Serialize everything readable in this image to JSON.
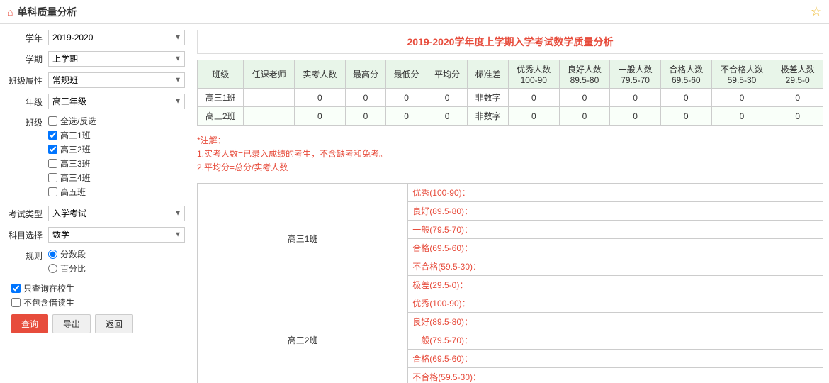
{
  "header": {
    "title": "单科质量分析",
    "star_icon": "☆"
  },
  "sidebar": {
    "fields": [
      {
        "label": "学年",
        "value": "2019-2020"
      },
      {
        "label": "学期",
        "value": "上学期"
      },
      {
        "label": "班级属性",
        "value": "常规班"
      },
      {
        "label": "年级",
        "value": "高三年级"
      }
    ],
    "class_label": "班级",
    "select_all_label": "全选/反选",
    "classes": [
      {
        "name": "高三1班",
        "checked": true
      },
      {
        "name": "高三2班",
        "checked": true
      },
      {
        "name": "高三3班",
        "checked": false
      },
      {
        "name": "高三4班",
        "checked": false
      },
      {
        "name": "高五班",
        "checked": false
      }
    ],
    "exam_type_label": "考试类型",
    "exam_type_value": "入学考试",
    "subject_label": "科目选择",
    "subject_value": "数学",
    "rules_label": "规则",
    "rules": [
      {
        "name": "分数段",
        "checked": true
      },
      {
        "name": "百分比",
        "checked": false
      }
    ],
    "extra_options": [
      {
        "label": "只查询在校生",
        "checked": true
      },
      {
        "label": "不包含借读生",
        "checked": false
      }
    ],
    "buttons": [
      {
        "label": "查询",
        "type": "primary"
      },
      {
        "label": "导出",
        "type": "default"
      },
      {
        "label": "返回",
        "type": "default"
      }
    ]
  },
  "content": {
    "report_title": "2019-2020学年度上学期入学考试数学质量分析",
    "table_headers": [
      "班级",
      "任课老师",
      "实考人数",
      "最高分",
      "最低分",
      "平均分",
      "标准差",
      "优秀人数\n100-90",
      "良好人数\n89.5-80",
      "一般人数\n79.5-70",
      "合格人数\n69.5-60",
      "不合格人数\n59.5-30",
      "极差人数\n29.5-0"
    ],
    "table_rows": [
      {
        "class": "高三1班",
        "teacher": "",
        "actual": "0",
        "max": "0",
        "min": "0",
        "avg": "0",
        "std": "非数字",
        "excellent": "0",
        "good": "0",
        "normal": "0",
        "pass": "0",
        "fail": "0",
        "poor": "0"
      },
      {
        "class": "高三2班",
        "teacher": "",
        "actual": "0",
        "max": "0",
        "min": "0",
        "avg": "0",
        "std": "非数字",
        "excellent": "0",
        "good": "0",
        "normal": "0",
        "pass": "0",
        "fail": "0",
        "poor": "0"
      }
    ],
    "notes": [
      "*注解：",
      "1.实考人数=已录入成绩的考生，不含缺考和免考。",
      "2.平均分=总分/实考人数"
    ],
    "detail_rows": [
      {
        "class": "高三1班",
        "items": [
          "优秀(100-90)：",
          "良好(89.5-80)：",
          "一般(79.5-70)：",
          "合格(69.5-60)：",
          "不合格(59.5-30)：",
          "极差(29.5-0)："
        ]
      },
      {
        "class": "高三2班",
        "items": [
          "优秀(100-90)：",
          "良好(89.5-80)：",
          "一般(79.5-70)：",
          "合格(69.5-60)：",
          "不合格(59.5-30)："
        ]
      }
    ]
  }
}
